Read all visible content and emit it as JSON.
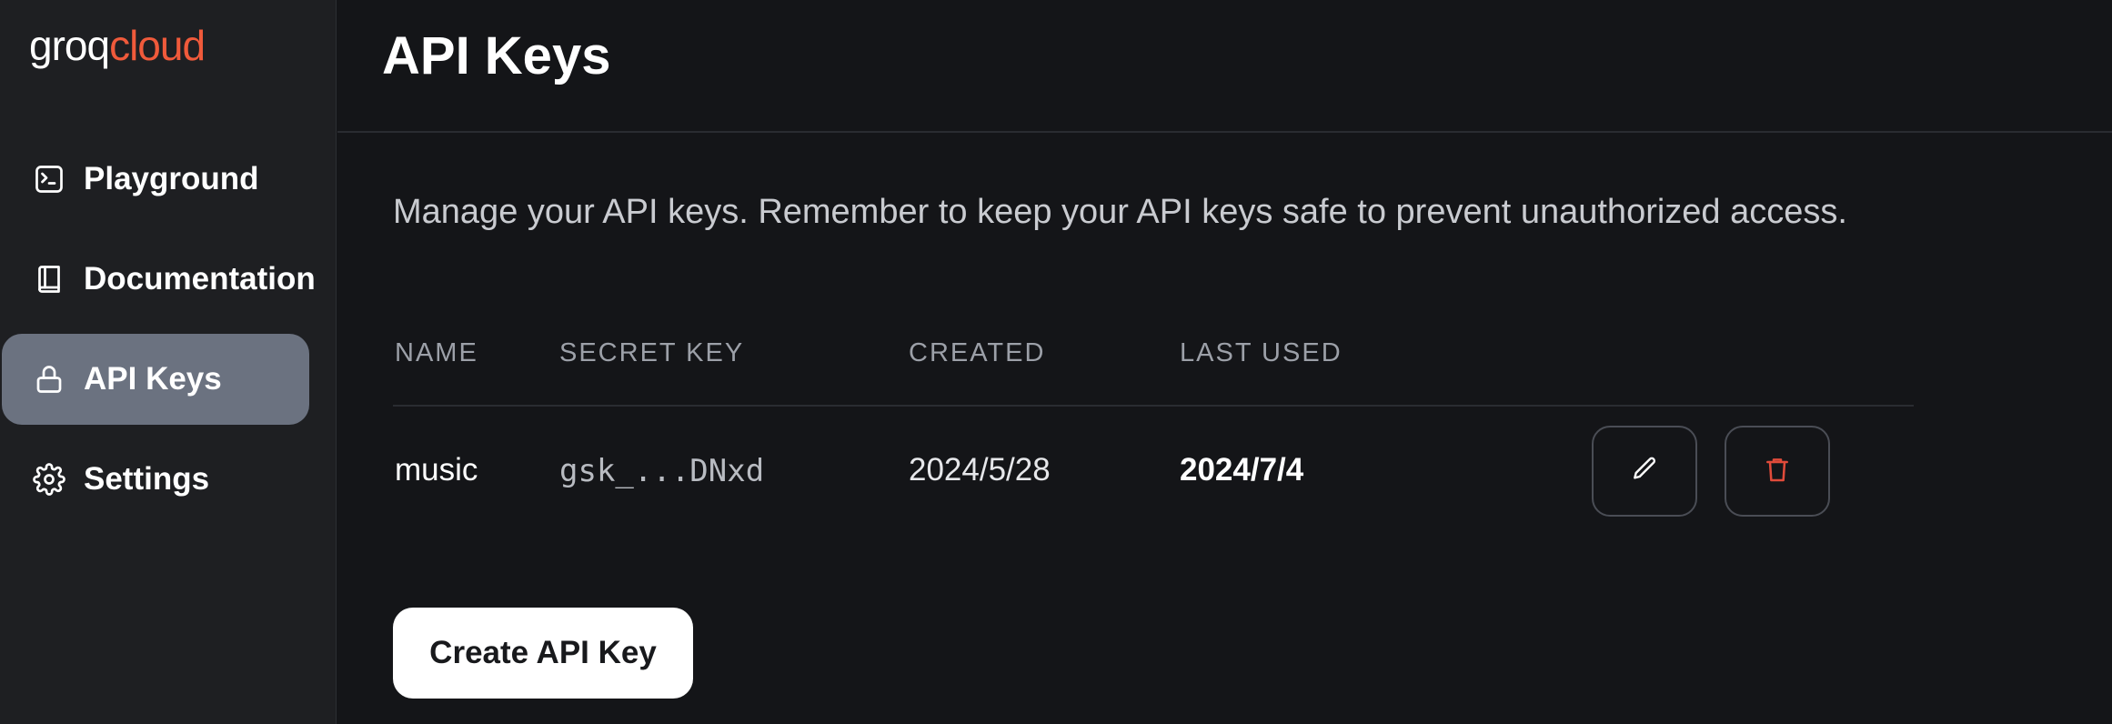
{
  "brand": {
    "part1": "groq",
    "part2": "cloud",
    "accent": "#f05a3b"
  },
  "sidebar": {
    "items": [
      {
        "label": "Playground",
        "icon": "terminal-icon",
        "active": false
      },
      {
        "label": "Documentation",
        "icon": "book-icon",
        "active": false
      },
      {
        "label": "API Keys",
        "icon": "lock-icon",
        "active": true
      },
      {
        "label": "Settings",
        "icon": "gear-icon",
        "active": false
      }
    ]
  },
  "main": {
    "title": "API Keys",
    "description": "Manage your API keys. Remember to keep your API keys safe to prevent unauthorized access.",
    "table": {
      "headers": [
        "NAME",
        "SECRET KEY",
        "CREATED",
        "LAST USED"
      ],
      "rows": [
        {
          "name": "music",
          "secret_key": "gsk_...DNxd",
          "created": "2024/5/28",
          "last_used": "2024/7/4"
        }
      ],
      "actions": {
        "edit_icon": "pencil-icon",
        "delete_icon": "trash-icon",
        "delete_color": "#e04b3a"
      }
    },
    "create_button": "Create API Key"
  }
}
